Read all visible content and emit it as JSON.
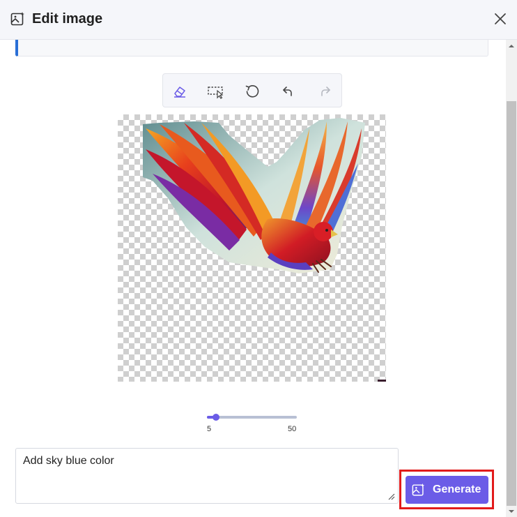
{
  "header": {
    "title": "Edit image",
    "title_icon": "image-sparkle-icon",
    "close_icon": "close-icon"
  },
  "notice": {
    "text": "",
    "accent_color": "#2a6fd6"
  },
  "toolbar": {
    "tools": [
      {
        "name": "eraser-icon"
      },
      {
        "name": "select-area-icon"
      },
      {
        "name": "reset-icon"
      },
      {
        "name": "undo-icon"
      },
      {
        "name": "redo-icon"
      }
    ]
  },
  "canvas": {
    "image": "phoenix-bird-cutout"
  },
  "brush_size": {
    "min_label": "5",
    "max_label": "50",
    "value": 5,
    "min": 5,
    "max": 50
  },
  "prompt": {
    "value": "Add sky blue color"
  },
  "generate_button": {
    "label": "Generate",
    "color": "#6b5ce7"
  }
}
